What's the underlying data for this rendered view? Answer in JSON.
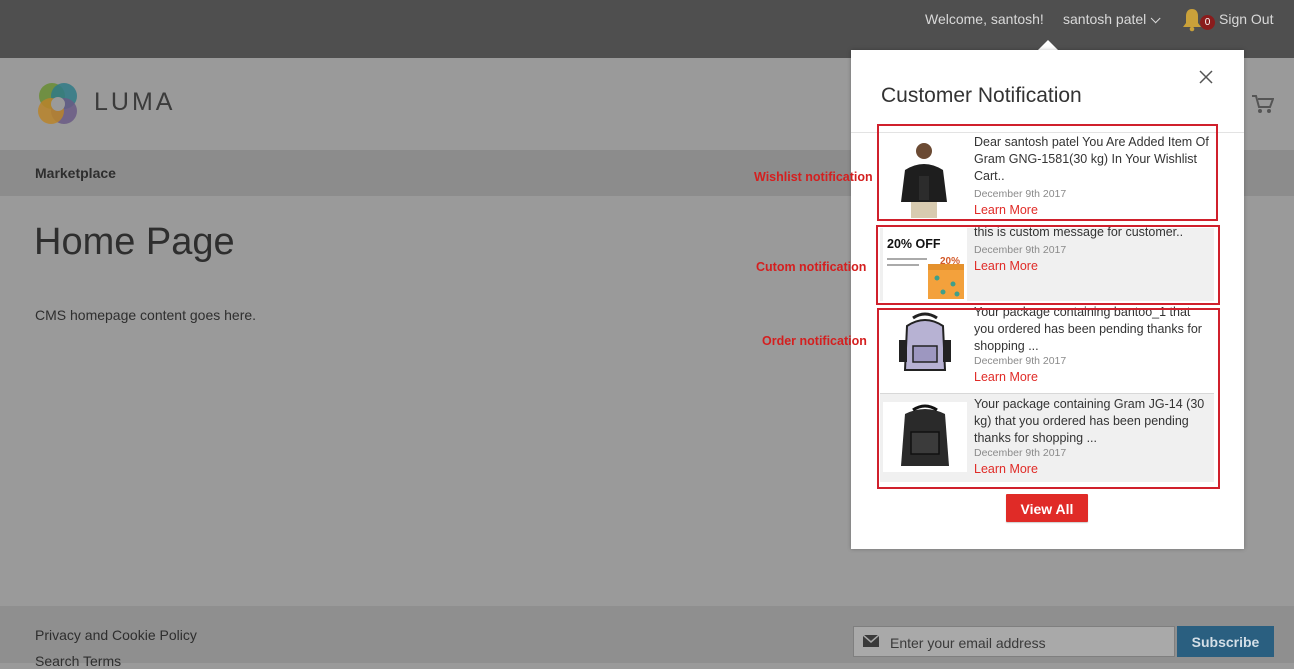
{
  "topbar": {
    "welcome": "Welcome, santosh!",
    "user_name": "santosh patel",
    "notification_count": "0",
    "sign_out": "Sign Out"
  },
  "header": {
    "logo_text": "LUMA"
  },
  "nav": {
    "items": [
      "Marketplace"
    ]
  },
  "main": {
    "title": "Home Page",
    "content": "CMS homepage content goes here."
  },
  "footer": {
    "links": [
      "Privacy and Cookie Policy",
      "Search Terms"
    ],
    "newsletter_placeholder": "Enter your email address",
    "subscribe_label": "Subscribe"
  },
  "modal": {
    "title": "Customer Notification",
    "notifications": [
      {
        "type": "wishlist",
        "thumb_icon": "jacket-man-icon",
        "message": "Dear santosh patel You Are Added Item Of Gram GNG-1581(30 kg) In Your Wishlist Cart..",
        "date": "December 9th 2017",
        "link": "Learn More"
      },
      {
        "type": "custom",
        "thumb_icon": "sale-banner-icon",
        "thumb_text": "20% OFF",
        "thumb_small": "20%",
        "message": "this is custom message for customer..",
        "date": "December 9th 2017",
        "link": "Learn More"
      },
      {
        "type": "order",
        "thumb_icon": "backpack-grey-icon",
        "message": "Your package containing bantoo_1 that you ordered has been pending thanks for shopping ...",
        "date": "December 9th 2017",
        "link": "Learn More"
      },
      {
        "type": "order",
        "thumb_icon": "backpack-black-icon",
        "message": "Your package containing Gram JG-14 (30 kg) that you ordered has been pending thanks for shopping ...",
        "date": "December 9th 2017",
        "link": "Learn More"
      }
    ],
    "view_all": "View All"
  },
  "annotations": {
    "wishlist": "Wishlist notification",
    "custom": "Cutom notification",
    "order": "Order notification"
  },
  "colors": {
    "accent_red": "#e02b27",
    "annotation_red": "#d0202c",
    "subscribe_blue": "#2a5f80"
  }
}
